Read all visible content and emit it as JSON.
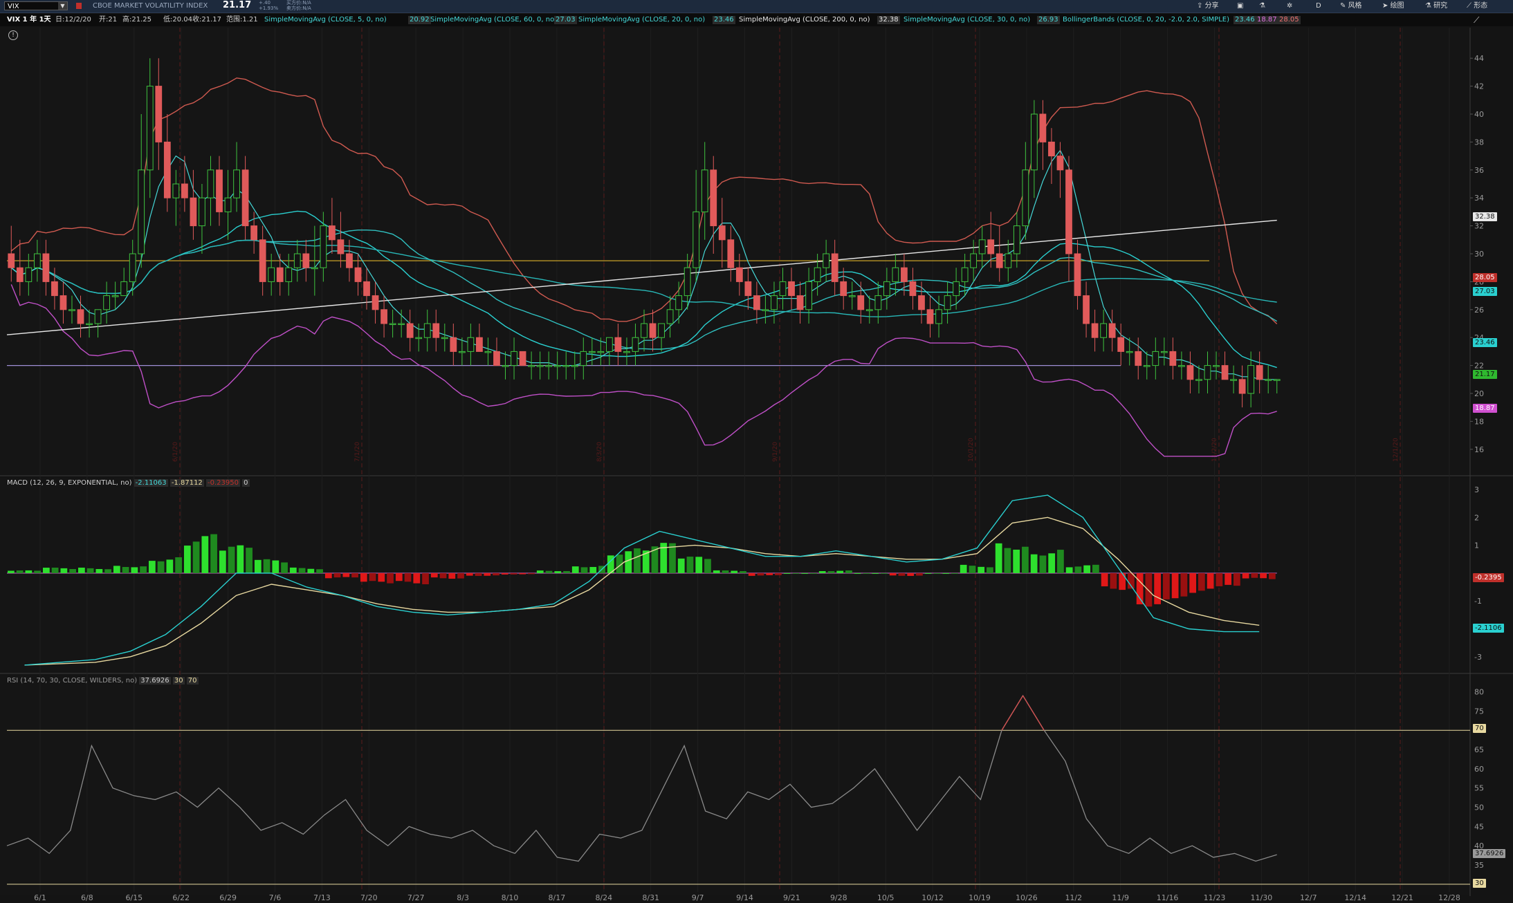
{
  "header": {
    "symbol": "VIX",
    "title": "CBOE MARKET VOLATILITY INDEX",
    "last": "21.17",
    "change": "+.40",
    "change_pct": "+1.93%",
    "bid": "买方价:N/A",
    "ask": "卖方价:N/A",
    "buttons": [
      "分享",
      "D",
      "风格",
      "绘图",
      "研究",
      "形态"
    ]
  },
  "infobar": {
    "period": "VIX 1 年 1天",
    "date": "日:12/2/20",
    "open": "开:21",
    "high": "高:21.25",
    "low": "低:20.04",
    "close": "收:21.17",
    "range": "范围:1.21",
    "studies": [
      {
        "label": "SimpleMovingAvg (CLOSE, 5, 0, no)",
        "value": "20.92",
        "color": "#45d8d8"
      },
      {
        "label": "SimpleMovingAvg (CLOSE, 60, 0, no)",
        "value": "27.03",
        "color": "#45d8d8"
      },
      {
        "label": "SimpleMovingAvg (CLOSE, 20, 0, no)",
        "value": "23.46",
        "color": "#45d8d8"
      },
      {
        "label": "SimpleMovingAvg (CLOSE, 200, 0, no)",
        "value": "32.38",
        "color": "#e8e8e8"
      },
      {
        "label": "SimpleMovingAvg (CLOSE, 30, 0, no)",
        "value": "26.93",
        "color": "#45d8d8"
      },
      {
        "label": "BollingerBands (CLOSE, 0, 20, -2.0, 2.0, SIMPLE)",
        "values": [
          "23.46",
          "18.87",
          "28.05"
        ],
        "colors": [
          "#45d8d8",
          "#e070e0",
          "#f07070"
        ]
      }
    ]
  },
  "price_panel": {
    "y_ticks": [
      "44",
      "42",
      "40",
      "38",
      "36",
      "34",
      "32",
      "30",
      "28",
      "26",
      "24",
      "22",
      "20",
      "18",
      "16"
    ],
    "tags": {
      "sma200": "32.38",
      "upper": "28.05",
      "sma60": "27.03",
      "sma20": "23.46",
      "last": "21.17",
      "lower": "18.87"
    },
    "date_marks": [
      "6/1/20",
      "7/1/20",
      "8/3/20",
      "9/1/20",
      "10/1/20",
      "11/2/20",
      "12/1/20"
    ]
  },
  "macd_panel": {
    "title": "MACD (12, 26, 9, EXPONENTIAL, no)",
    "values": [
      "-2.11063",
      "-1.87112",
      "-0.23950",
      "0"
    ],
    "value_colors": [
      "#45d8d8",
      "#e8d9a0",
      "#c0302b",
      "#cfcfcf"
    ],
    "y_ticks": [
      "3",
      "2",
      "1",
      "-1",
      "-2",
      "-3"
    ],
    "tags": {
      "hist": "-0.2395",
      "value": "-2.1106"
    }
  },
  "rsi_panel": {
    "title": "RSI (14, 70, 30, CLOSE, WILDERS, no)",
    "values": [
      "37.6926",
      "30",
      "70"
    ],
    "y_ticks": [
      "80",
      "75",
      "65",
      "60",
      "55",
      "50",
      "45",
      "40",
      "35"
    ],
    "tags": {
      "ob": "70",
      "value": "37.6926",
      "os": "30"
    }
  },
  "x_axis": [
    "6/1",
    "6/8",
    "6/15",
    "6/22",
    "6/29",
    "7/6",
    "7/13",
    "7/20",
    "7/27",
    "8/3",
    "8/10",
    "8/17",
    "8/24",
    "8/31",
    "9/7",
    "9/14",
    "9/21",
    "9/28",
    "10/5",
    "10/12",
    "10/19",
    "10/26",
    "11/2",
    "11/9",
    "11/16",
    "11/23",
    "11/30",
    "12/7",
    "12/14",
    "12/21",
    "12/28"
  ],
  "chart_data": [
    {
      "type": "candlestick",
      "symbol": "VIX",
      "ylim": [
        15,
        45
      ],
      "date_range": [
        "5/26/20",
        "12/2/20"
      ],
      "ohlc": [
        [
          30,
          32,
          28,
          29
        ],
        [
          29,
          31,
          27,
          28
        ],
        [
          28,
          30,
          27,
          29
        ],
        [
          29,
          31,
          28,
          30
        ],
        [
          30,
          31,
          27,
          28
        ],
        [
          28,
          29,
          26,
          27
        ],
        [
          27,
          28,
          25,
          26
        ],
        [
          26,
          27,
          25,
          26
        ],
        [
          26,
          27,
          24,
          25
        ],
        [
          25,
          26,
          24,
          25
        ],
        [
          25,
          26,
          24,
          26
        ],
        [
          26,
          28,
          25,
          27
        ],
        [
          27,
          28,
          26,
          27
        ],
        [
          27,
          29,
          27,
          28
        ],
        [
          28,
          31,
          27,
          30
        ],
        [
          30,
          40,
          29,
          36
        ],
        [
          36,
          44,
          34,
          42
        ],
        [
          42,
          44,
          36,
          38
        ],
        [
          38,
          40,
          33,
          34
        ],
        [
          34,
          36,
          32,
          35
        ],
        [
          35,
          37,
          33,
          34
        ],
        [
          34,
          36,
          31,
          32
        ],
        [
          32,
          35,
          30,
          34
        ],
        [
          34,
          37,
          32,
          36
        ],
        [
          36,
          37,
          32,
          33
        ],
        [
          33,
          36,
          31,
          34
        ],
        [
          34,
          38,
          33,
          36
        ],
        [
          36,
          37,
          31,
          32
        ],
        [
          32,
          33,
          30,
          31
        ],
        [
          31,
          32,
          27,
          28
        ],
        [
          28,
          30,
          27,
          29
        ],
        [
          29,
          30,
          27,
          28
        ],
        [
          28,
          30,
          27,
          29
        ],
        [
          29,
          31,
          28,
          30
        ],
        [
          30,
          31,
          28,
          29
        ],
        [
          29,
          32,
          27,
          29
        ],
        [
          29,
          33,
          28,
          32
        ],
        [
          32,
          34,
          30,
          31
        ],
        [
          31,
          33,
          29,
          30
        ],
        [
          30,
          31,
          28,
          29
        ],
        [
          29,
          30,
          27,
          28
        ],
        [
          28,
          29,
          26,
          27
        ],
        [
          27,
          28,
          25,
          26
        ],
        [
          26,
          27,
          24,
          25
        ],
        [
          25,
          26,
          24,
          25
        ],
        [
          25,
          26,
          24,
          25
        ],
        [
          25,
          26,
          23,
          24
        ],
        [
          24,
          25,
          23,
          24
        ],
        [
          24,
          26,
          23,
          25
        ],
        [
          25,
          26,
          23,
          24
        ],
        [
          24,
          25,
          23,
          24
        ],
        [
          24,
          25,
          22,
          23
        ],
        [
          23,
          24,
          22,
          23
        ],
        [
          23,
          25,
          22,
          24
        ],
        [
          24,
          25,
          23,
          23
        ],
        [
          23,
          24,
          22,
          23
        ],
        [
          23,
          24,
          22,
          22
        ],
        [
          22,
          23,
          21,
          22
        ],
        [
          22,
          24,
          21,
          23
        ],
        [
          23,
          23,
          22,
          22
        ],
        [
          22,
          23,
          21,
          22
        ],
        [
          22,
          23,
          21,
          22
        ],
        [
          22,
          23,
          21,
          22
        ],
        [
          22,
          23,
          21,
          22
        ],
        [
          22,
          23,
          21,
          22
        ],
        [
          22,
          23,
          21,
          22
        ],
        [
          22,
          24,
          21,
          23
        ],
        [
          23,
          24,
          22,
          23
        ],
        [
          23,
          24,
          22,
          23
        ],
        [
          23,
          24,
          22,
          24
        ],
        [
          24,
          25,
          22,
          23
        ],
        [
          23,
          24,
          22,
          23
        ],
        [
          23,
          25,
          22,
          24
        ],
        [
          24,
          26,
          23,
          25
        ],
        [
          25,
          26,
          23,
          24
        ],
        [
          24,
          25,
          23,
          25
        ],
        [
          25,
          27,
          24,
          26
        ],
        [
          26,
          28,
          25,
          27
        ],
        [
          27,
          30,
          26,
          29
        ],
        [
          29,
          36,
          28,
          33
        ],
        [
          33,
          38,
          31,
          36
        ],
        [
          36,
          37,
          30,
          32
        ],
        [
          32,
          34,
          29,
          31
        ],
        [
          31,
          32,
          28,
          29
        ],
        [
          29,
          30,
          27,
          28
        ],
        [
          28,
          29,
          26,
          27
        ],
        [
          27,
          28,
          25,
          26
        ],
        [
          26,
          27,
          25,
          26
        ],
        [
          26,
          28,
          25,
          27
        ],
        [
          27,
          29,
          26,
          28
        ],
        [
          28,
          29,
          26,
          27
        ],
        [
          27,
          28,
          25,
          26
        ],
        [
          26,
          29,
          25,
          28
        ],
        [
          28,
          30,
          27,
          29
        ],
        [
          29,
          31,
          28,
          30
        ],
        [
          30,
          31,
          27,
          28
        ],
        [
          28,
          29,
          26,
          27
        ],
        [
          27,
          28,
          26,
          27
        ],
        [
          27,
          28,
          25,
          26
        ],
        [
          26,
          27,
          25,
          26
        ],
        [
          26,
          28,
          25,
          27
        ],
        [
          27,
          29,
          26,
          28
        ],
        [
          28,
          30,
          27,
          29
        ],
        [
          29,
          30,
          27,
          28
        ],
        [
          28,
          29,
          26,
          27
        ],
        [
          27,
          28,
          25,
          26
        ],
        [
          26,
          27,
          24,
          25
        ],
        [
          25,
          27,
          24,
          26
        ],
        [
          26,
          28,
          25,
          27
        ],
        [
          27,
          29,
          26,
          28
        ],
        [
          28,
          30,
          27,
          29
        ],
        [
          29,
          31,
          28,
          30
        ],
        [
          30,
          32,
          29,
          31
        ],
        [
          31,
          33,
          29,
          30
        ],
        [
          30,
          32,
          28,
          29
        ],
        [
          29,
          31,
          28,
          30
        ],
        [
          30,
          33,
          29,
          32
        ],
        [
          32,
          38,
          31,
          36
        ],
        [
          36,
          41,
          34,
          40
        ],
        [
          40,
          41,
          36,
          38
        ],
        [
          38,
          39,
          35,
          37
        ],
        [
          37,
          38,
          34,
          36
        ],
        [
          36,
          37,
          28,
          30
        ],
        [
          30,
          31,
          26,
          27
        ],
        [
          27,
          28,
          24,
          25
        ],
        [
          25,
          26,
          23,
          24
        ],
        [
          24,
          26,
          23,
          25
        ],
        [
          25,
          26,
          23,
          24
        ],
        [
          24,
          25,
          22,
          23
        ],
        [
          23,
          24,
          22,
          23
        ],
        [
          23,
          24,
          21,
          22
        ],
        [
          22,
          23,
          21,
          22
        ],
        [
          22,
          24,
          21,
          23
        ],
        [
          23,
          24,
          22,
          23
        ],
        [
          23,
          24,
          21,
          22
        ],
        [
          22,
          23,
          21,
          22
        ],
        [
          22,
          23,
          20,
          21
        ],
        [
          21,
          22,
          20,
          21
        ],
        [
          21,
          23,
          20,
          22
        ],
        [
          22,
          23,
          21,
          22
        ],
        [
          22,
          23,
          21,
          21
        ],
        [
          21,
          22,
          20,
          21
        ],
        [
          21,
          22,
          19,
          20
        ],
        [
          20,
          23,
          19,
          22
        ],
        [
          22,
          23,
          20,
          21
        ],
        [
          21,
          22,
          20,
          21
        ],
        [
          21,
          21,
          20,
          21
        ]
      ],
      "sma200_endpoints": [
        [
          0,
          24.2
        ],
        [
          1,
          32.4
        ]
      ],
      "horizontal_lines": [
        29.5,
        22.0
      ],
      "last_close": 21.17
    },
    {
      "type": "line",
      "title": "MACD (12, 26, 9, EXPONENTIAL, no)",
      "ylim": [
        -3.5,
        3
      ],
      "series": [
        {
          "name": "Value",
          "values": [
            -3.3,
            -3.2,
            -3.1,
            -2.8,
            -2.2,
            -1.2,
            0.0,
            0.0,
            -0.5,
            -0.8,
            -1.2,
            -1.4,
            -1.5,
            -1.4,
            -1.3,
            -1.1,
            -0.3,
            0.9,
            1.5,
            1.2,
            0.9,
            0.6,
            0.6,
            0.8,
            0.6,
            0.4,
            0.5,
            0.9,
            2.6,
            2.8,
            2.0,
            0.2,
            -1.6,
            -2.0,
            -2.1,
            -2.1
          ]
        },
        {
          "name": "Avg",
          "values": [
            -3.3,
            -3.25,
            -3.2,
            -3.0,
            -2.6,
            -1.8,
            -0.8,
            -0.4,
            -0.6,
            -0.8,
            -1.1,
            -1.3,
            -1.4,
            -1.4,
            -1.3,
            -1.2,
            -0.6,
            0.4,
            0.9,
            1.0,
            0.9,
            0.7,
            0.6,
            0.7,
            0.6,
            0.5,
            0.5,
            0.7,
            1.8,
            2.0,
            1.6,
            0.5,
            -0.8,
            -1.4,
            -1.7,
            -1.87
          ]
        }
      ],
      "histogram": [
        0.1,
        0.2,
        0.2,
        0.3,
        0.6,
        1.4,
        1.0,
        0.5,
        0.2,
        -0.2,
        -0.4,
        -0.4,
        -0.2,
        -0.1,
        -0.05,
        0.1,
        0.3,
        0.9,
        1.1,
        0.6,
        0.1,
        -0.1,
        0.0,
        0.1,
        0.0,
        -0.1,
        0.0,
        0.3,
        1.2,
        0.9,
        0.3,
        -0.6,
        -1.2,
        -0.9,
        -0.6,
        -0.24
      ]
    },
    {
      "type": "line",
      "title": "RSI (14, 70, 30, CLOSE, WILDERS, no)",
      "ylim": [
        28,
        81
      ],
      "series": [
        {
          "name": "RSI",
          "values": [
            40,
            42,
            38,
            44,
            66,
            55,
            53,
            52,
            54,
            50,
            55,
            50,
            44,
            46,
            43,
            48,
            52,
            44,
            40,
            45,
            43,
            42,
            44,
            40,
            38,
            44,
            37,
            36,
            43,
            42,
            44,
            55,
            66,
            49,
            47,
            54,
            52,
            56,
            50,
            51,
            55,
            60,
            52,
            44,
            51,
            58,
            52,
            70,
            79,
            70,
            62,
            47,
            40,
            38,
            42,
            38,
            40,
            37,
            38,
            36,
            37.69
          ]
        }
      ],
      "levels": [
        70,
        30
      ]
    }
  ]
}
